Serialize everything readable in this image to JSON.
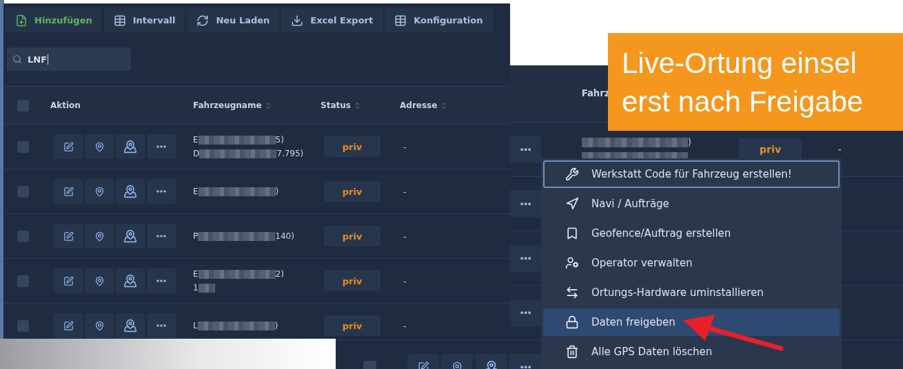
{
  "main_window": {
    "toolbar": [
      {
        "label": "Hinzufügen",
        "kind": "primary"
      },
      {
        "label": "Intervall",
        "kind": "default"
      },
      {
        "label": "Neu Laden",
        "kind": "default"
      },
      {
        "label": "Excel Export",
        "kind": "default"
      },
      {
        "label": "Konfiguration",
        "kind": "default"
      }
    ],
    "search": {
      "value": "LNF"
    },
    "table": {
      "header_checked": false,
      "columns": [
        "Aktion",
        "Fahrzeugname",
        "Status",
        "Adresse"
      ],
      "rows": [
        {
          "checked": false,
          "name_start": "E",
          "name_end": "5)",
          "sub_start": "D",
          "sub_end": "7.795)",
          "status": "priv",
          "address": "-"
        },
        {
          "checked": false,
          "name_start": "E",
          "name_end": ")",
          "status": "priv",
          "address": "-"
        },
        {
          "checked": false,
          "name_start": "P",
          "name_end": "140)",
          "status": "priv",
          "address": "-"
        },
        {
          "checked": false,
          "name_start": "E",
          "name_end": "2)",
          "sub_start": "1",
          "status": "priv",
          "address": "-"
        },
        {
          "checked": false,
          "name_start": "L",
          "name_end": ")",
          "status": "priv",
          "address": "-"
        }
      ]
    }
  },
  "second_window": {
    "column_header": "Fahrz",
    "rows": [
      {
        "name_end": ")",
        "status": "priv",
        "address": "-"
      },
      {},
      {},
      {},
      {
        "checked": false
      }
    ],
    "menu": [
      {
        "label": "Werkstatt Code für Fahrzeug erstellen!",
        "focused": true,
        "selected": false
      },
      {
        "label": "Navi / Aufträge",
        "focused": false,
        "selected": false
      },
      {
        "label": "Geofence/Auftrag erstellen",
        "focused": false,
        "selected": false
      },
      {
        "label": "Operator verwalten",
        "focused": false,
        "selected": false
      },
      {
        "label": "Ortungs-Hardware uminstallieren",
        "focused": false,
        "selected": false
      },
      {
        "label": "Daten freigeben",
        "focused": false,
        "selected": true
      },
      {
        "label": "Alle GPS Daten löschen",
        "focused": false,
        "selected": false
      }
    ]
  },
  "banner": {
    "lines": [
      "Live-Ortung einsel",
      "erst nach Freigabe"
    ]
  }
}
